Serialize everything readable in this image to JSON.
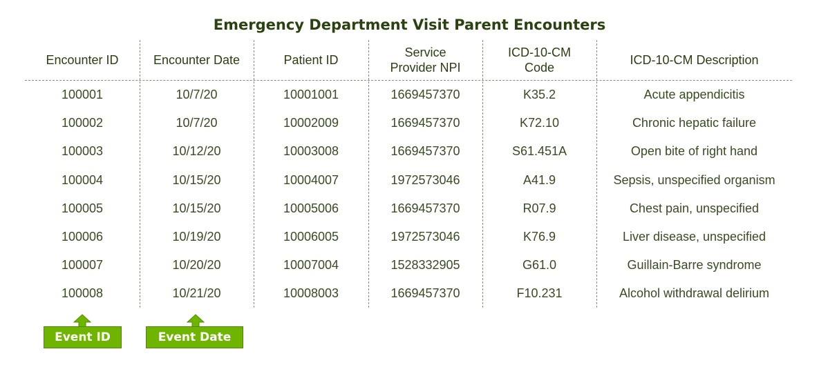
{
  "title": "Emergency Department Visit Parent Encounters",
  "columns": [
    {
      "label_line1": "Encounter ID",
      "label_line2": ""
    },
    {
      "label_line1": "Encounter Date",
      "label_line2": ""
    },
    {
      "label_line1": "Patient ID",
      "label_line2": ""
    },
    {
      "label_line1": "Service",
      "label_line2": "Provider NPI"
    },
    {
      "label_line1": "ICD-10-CM",
      "label_line2": "Code"
    },
    {
      "label_line1": "ICD-10-CM Description",
      "label_line2": ""
    }
  ],
  "rows": [
    [
      "100001",
      "10/7/20",
      "10001001",
      "1669457370",
      "K35.2",
      "Acute appendicitis"
    ],
    [
      "100002",
      "10/7/20",
      "10002009",
      "1669457370",
      "K72.10",
      "Chronic hepatic failure"
    ],
    [
      "100003",
      "10/12/20",
      "10003008",
      "1669457370",
      "S61.451A",
      "Open bite of right hand"
    ],
    [
      "100004",
      "10/15/20",
      "10004007",
      "1972573046",
      "A41.9",
      "Sepsis, unspecified organism"
    ],
    [
      "100005",
      "10/15/20",
      "10005006",
      "1669457370",
      "R07.9",
      "Chest pain, unspecified"
    ],
    [
      "100006",
      "10/19/20",
      "10006005",
      "1972573046",
      "K76.9",
      "Liver disease, unspecified"
    ],
    [
      "100007",
      "10/20/20",
      "10007004",
      "1528332905",
      "G61.0",
      "Guillain-Barre syndrome"
    ],
    [
      "100008",
      "10/21/20",
      "10008003",
      "1669457370",
      "F10.231",
      "Alcohol withdrawal delirium"
    ]
  ],
  "annotations": [
    {
      "label": "Event ID",
      "icon": "up-arrow-icon",
      "points_to_column": "Encounter ID"
    },
    {
      "label": "Event Date",
      "icon": "up-arrow-icon",
      "points_to_column": "Encounter Date"
    }
  ],
  "colors": {
    "title": "#2a4210",
    "text": "#3a4a22",
    "tag_fill": "#6fb500",
    "tag_border": "#4f8a00",
    "divider": "#8a8a7a"
  }
}
